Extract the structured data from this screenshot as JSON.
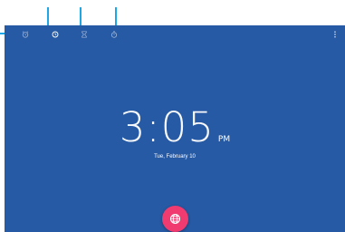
{
  "clock": {
    "time": "3:05",
    "ampm": "PM",
    "date": "Tue, February 10"
  },
  "toolbar": {
    "tabs": [
      {
        "name": "alarm",
        "icon": "alarm-icon"
      },
      {
        "name": "clock",
        "icon": "clock-icon",
        "selected": true
      },
      {
        "name": "timer",
        "icon": "hourglass-icon"
      },
      {
        "name": "stopwatch",
        "icon": "stopwatch-icon"
      }
    ],
    "overflow_icon": "more-vert-icon"
  },
  "fab": {
    "icon": "globe-icon"
  },
  "colors": {
    "background": "#275aa4",
    "fab": "#ef3b6f",
    "marker": "#1ea7e6",
    "text": "#ffffff"
  }
}
